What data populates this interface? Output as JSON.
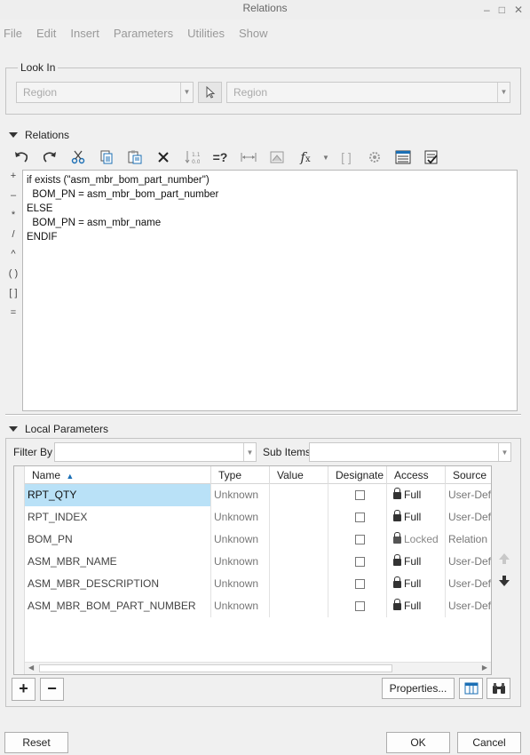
{
  "window": {
    "title": "Relations",
    "min": "–",
    "max": "□",
    "close": "✕"
  },
  "menu": [
    "File",
    "Edit",
    "Insert",
    "Parameters",
    "Utilities",
    "Show"
  ],
  "look_in": {
    "label": "Look In",
    "combo1": "Region",
    "combo2": "Region"
  },
  "relations": {
    "header": "Relations",
    "symbols": [
      "+",
      "–",
      "*",
      "/",
      "^",
      "( )",
      "[ ]",
      "="
    ],
    "lines": [
      "if exists (\"asm_mbr_bom_part_number\")",
      "  BOM_PN = asm_mbr_bom_part_number",
      "ELSE",
      "  BOM_PN = asm_mbr_name",
      "ENDIF"
    ],
    "toolbar_icons": [
      "undo-icon",
      "redo-icon",
      "cut-icon",
      "copy-icon",
      "paste-icon",
      "delete-icon",
      "sort-icon",
      "evaluate-icon",
      "dimension-icon",
      "display-icon",
      "function-icon",
      "function-menu-icon",
      "brackets-icon",
      "settings-icon",
      "insert-parameters-icon",
      "verify-icon"
    ]
  },
  "local_params": {
    "header": "Local Parameters",
    "filter_by_label": "Filter By",
    "sub_items_label": "Sub Items",
    "columns": [
      "Name",
      "Type",
      "Value",
      "Designate",
      "Access",
      "Source"
    ],
    "rows": [
      {
        "name": "RPT_QTY",
        "type": "Unknown",
        "value": "",
        "access": "Full",
        "source": "User-Defi"
      },
      {
        "name": "RPT_INDEX",
        "type": "Unknown",
        "value": "",
        "access": "Full",
        "source": "User-Defi"
      },
      {
        "name": "BOM_PN",
        "type": "Unknown",
        "value": "",
        "access": "Locked",
        "source": "Relation"
      },
      {
        "name": "ASM_MBR_NAME",
        "type": "Unknown",
        "value": "",
        "access": "Full",
        "source": "User-Defi"
      },
      {
        "name": "ASM_MBR_DESCRIPTION",
        "type": "Unknown",
        "value": "",
        "access": "Full",
        "source": "User-Defi"
      },
      {
        "name": "ASM_MBR_BOM_PART_NUMBER",
        "type": "Unknown",
        "value": "",
        "access": "Full",
        "source": "User-Defi"
      }
    ],
    "sort_indicator": "▲",
    "add": "+",
    "remove": "−",
    "properties": "Properties..."
  },
  "footer": {
    "reset": "Reset",
    "ok": "OK",
    "cancel": "Cancel"
  }
}
